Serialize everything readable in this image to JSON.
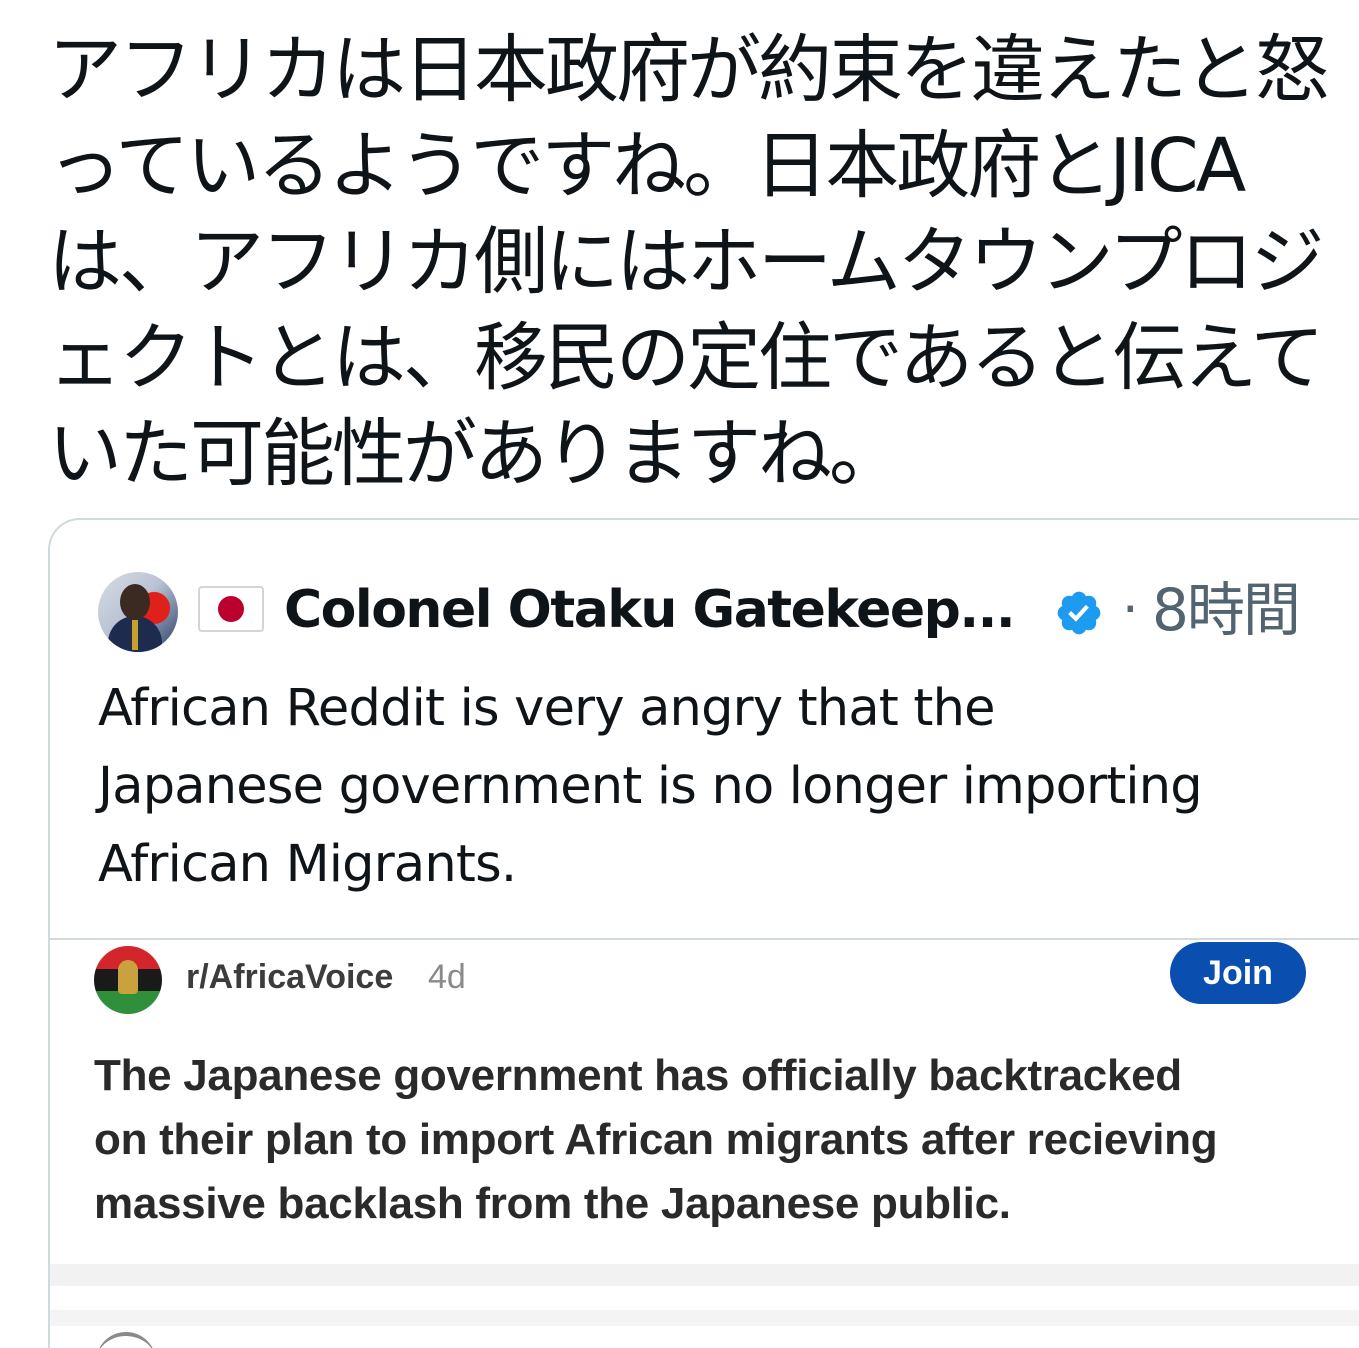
{
  "tweet": {
    "text_lines": [
      "アフリカは日本政府が約束を違えたと怒",
      "っているようですね。日本政府とJICA",
      "は、アフリカ側にはホームタウンプロジ",
      "ェクトとは、移民の定住であると伝えて",
      "いた可能性がありますね。"
    ]
  },
  "quote": {
    "flag_emoji": "🇯🇵",
    "author_name": "Colonel Otaku Gatekeep...",
    "verified": true,
    "separator": "·",
    "time": "8時間",
    "body_lines": [
      "African Reddit is very angry that the",
      "Japanese government is no longer importing",
      "African Migrants."
    ]
  },
  "reddit": {
    "subreddit": "r/AfricaVoice",
    "age": "4d",
    "join_label": "Join",
    "title_lines": [
      "The Japanese government has officially backtracked",
      "on their plan to import African migrants after recieving",
      "massive backlash from the Japanese public."
    ]
  },
  "colors": {
    "text": "#0f1419",
    "secondary": "#536471",
    "verified_blue": "#1d9bf0",
    "join_blue": "#0a4fb0",
    "card_border": "#cfd9de"
  }
}
